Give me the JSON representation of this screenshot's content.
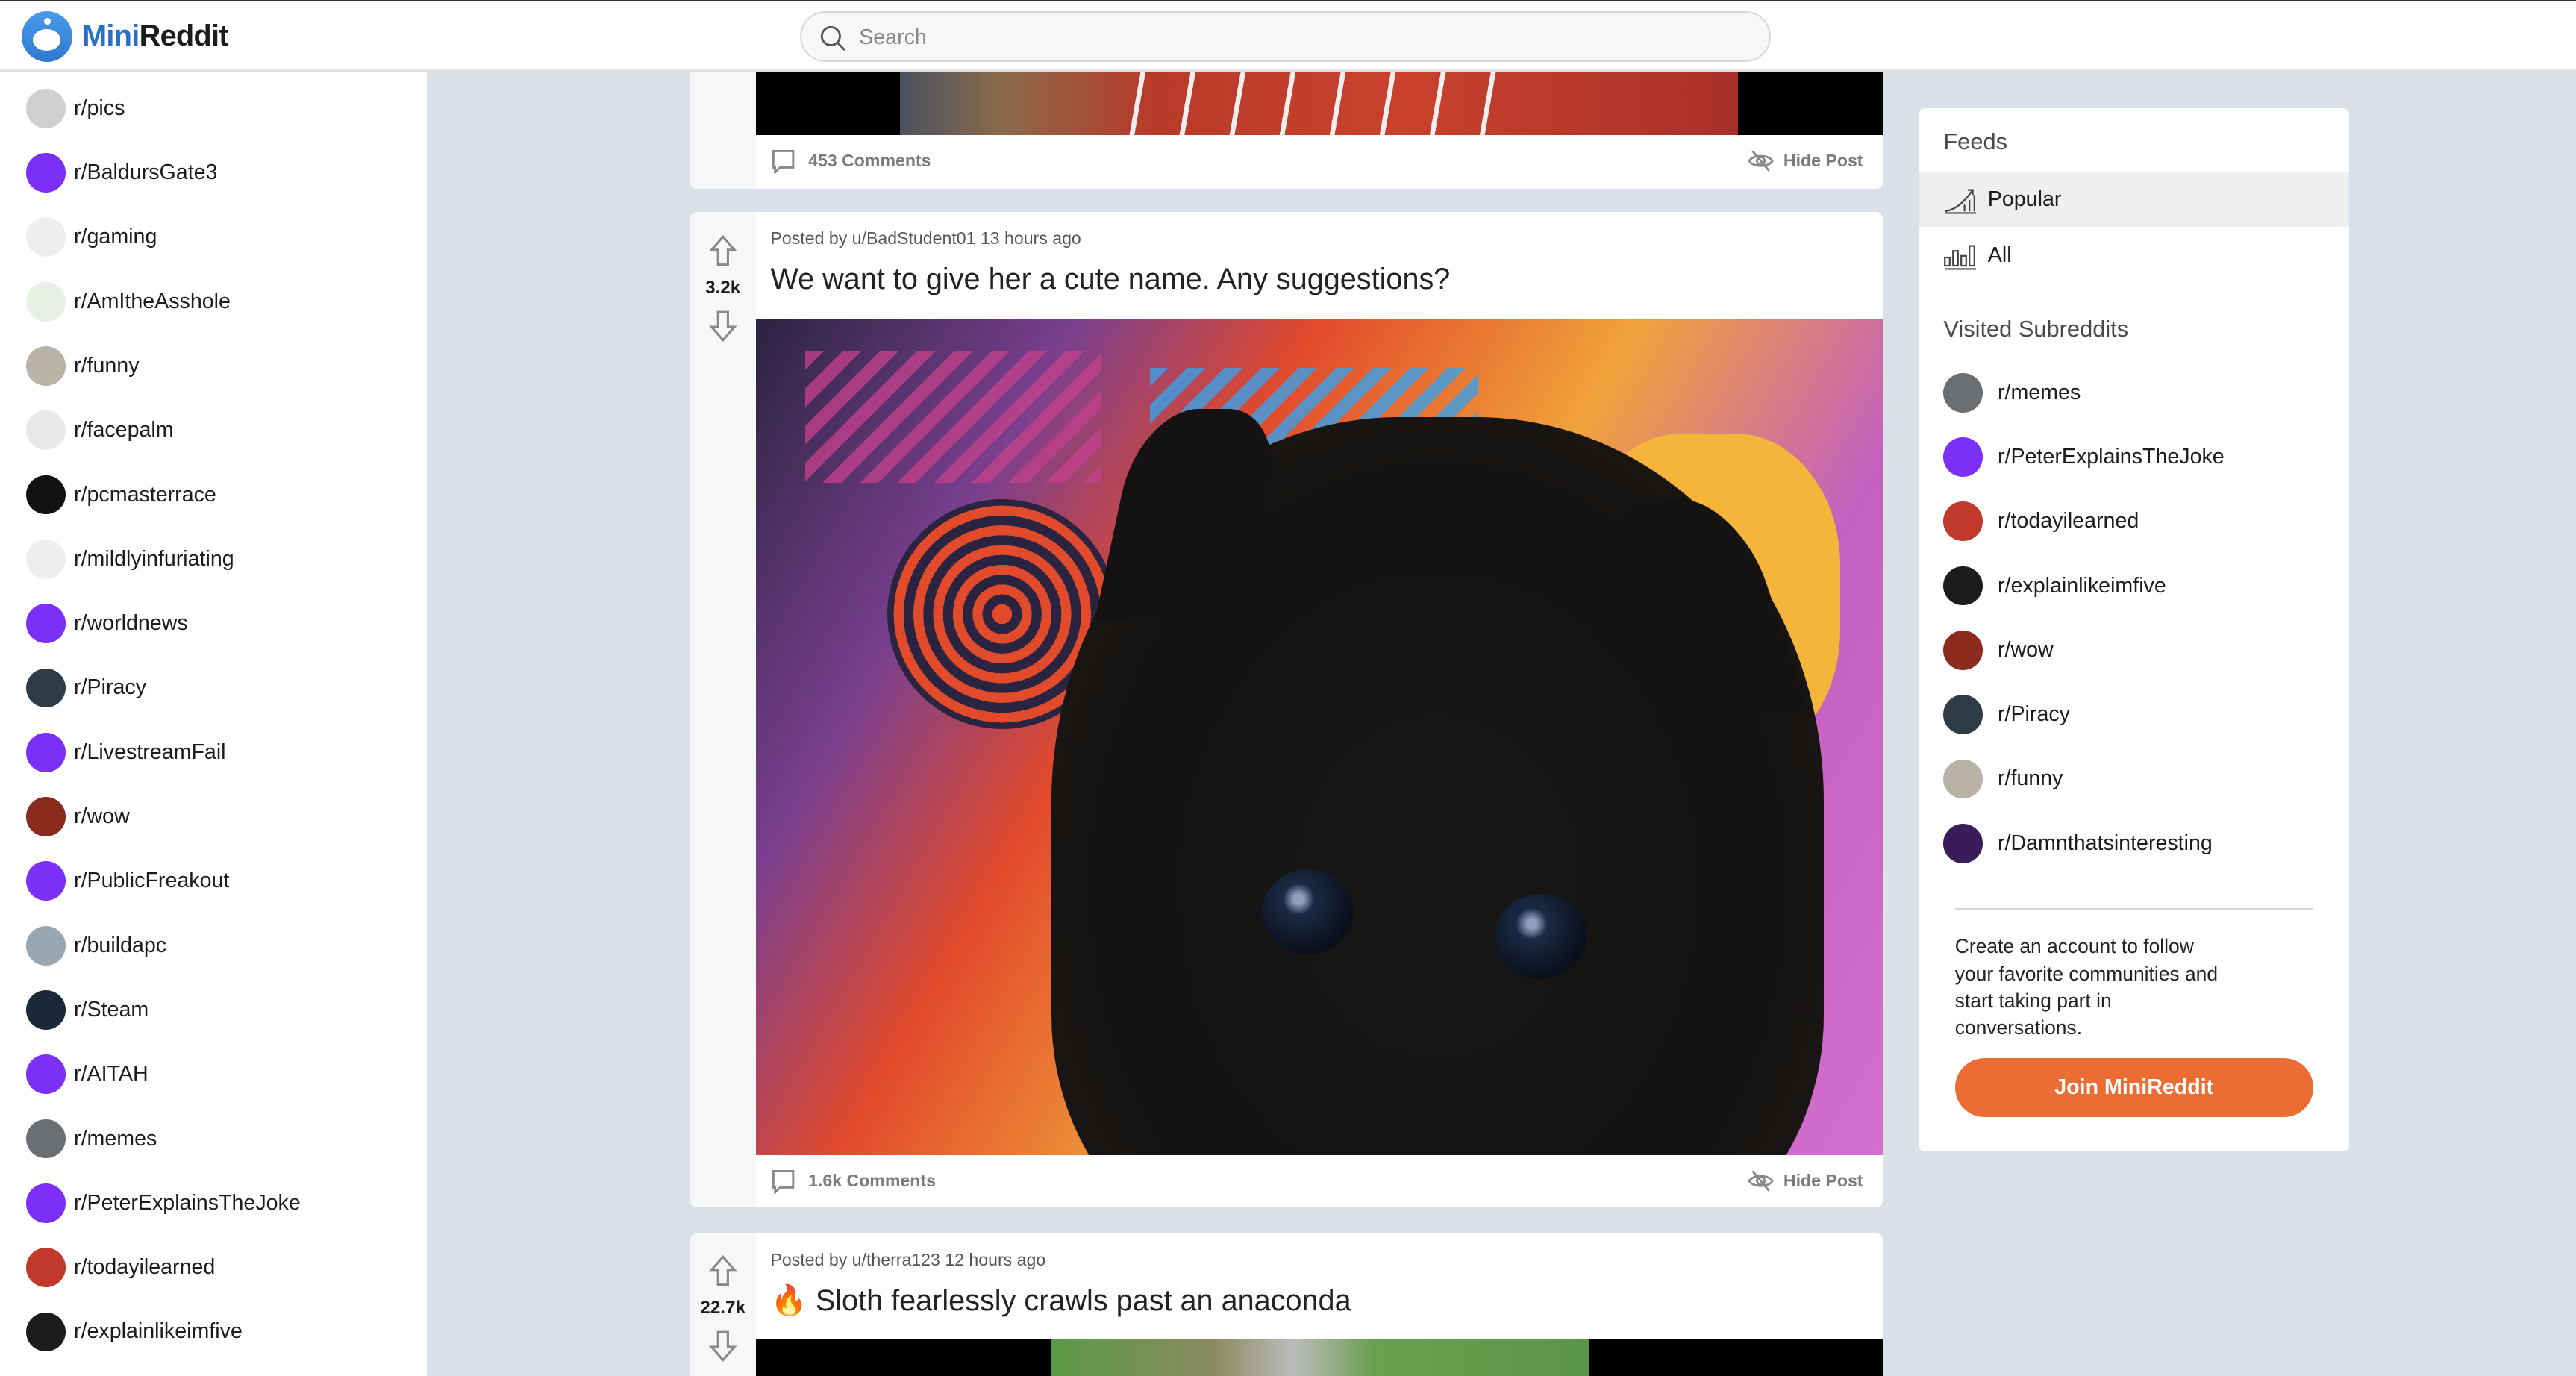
{
  "header": {
    "brand_part1": "Mini",
    "brand_part2": "Reddit",
    "search_placeholder": "Search",
    "search_value": ""
  },
  "sidebar": {
    "items": [
      {
        "label": "r/pics",
        "color": "#cfcfcf"
      },
      {
        "label": "r/BaldursGate3",
        "color": "#7b2ff7"
      },
      {
        "label": "r/gaming",
        "color": "#eeeeee"
      },
      {
        "label": "r/AmItheAsshole",
        "color": "#e8efe4"
      },
      {
        "label": "r/funny",
        "color": "#b9b2a6"
      },
      {
        "label": "r/facepalm",
        "color": "#e9e9e9"
      },
      {
        "label": "r/pcmasterrace",
        "color": "#111111"
      },
      {
        "label": "r/mildlyinfuriating",
        "color": "#eeeeee"
      },
      {
        "label": "r/worldnews",
        "color": "#7b2ff7"
      },
      {
        "label": "r/Piracy",
        "color": "#2f3b45"
      },
      {
        "label": "r/LivestreamFail",
        "color": "#7b2ff7"
      },
      {
        "label": "r/wow",
        "color": "#8a2b1e"
      },
      {
        "label": "r/PublicFreakout",
        "color": "#7b2ff7"
      },
      {
        "label": "r/buildapc",
        "color": "#9aa6b0"
      },
      {
        "label": "r/Steam",
        "color": "#1b2838"
      },
      {
        "label": "r/AITAH",
        "color": "#7b2ff7"
      },
      {
        "label": "r/memes",
        "color": "#6b6f73"
      },
      {
        "label": "r/PeterExplainsTheJoke",
        "color": "#7b2ff7"
      },
      {
        "label": "r/todayilearned",
        "color": "#c0392b"
      },
      {
        "label": "r/explainlikeimfive",
        "color": "#1c1c1c"
      }
    ]
  },
  "posts": [
    {
      "comments": "453 Comments",
      "hide": "Hide Post"
    },
    {
      "meta": "Posted by u/BadStudent01 13 hours ago",
      "title": "We want to give her a cute name. Any suggestions?",
      "votes": "3.2k",
      "comments": "1.6k Comments",
      "hide": "Hide Post"
    },
    {
      "meta": "Posted by u/therra123 12 hours ago",
      "flair_emoji": "🔥",
      "title": "Sloth fearlessly crawls past an anaconda",
      "votes": "22.7k"
    }
  ],
  "right": {
    "feeds_title": "Feeds",
    "feeds": [
      {
        "label": "Popular",
        "active": true
      },
      {
        "label": "All",
        "active": false
      }
    ],
    "visited_title": "Visited Subreddits",
    "visited": [
      {
        "label": "r/memes",
        "color": "#6b6f73"
      },
      {
        "label": "r/PeterExplainsTheJoke",
        "color": "#7b2ff7"
      },
      {
        "label": "r/todayilearned",
        "color": "#c0392b"
      },
      {
        "label": "r/explainlikeimfive",
        "color": "#1c1c1c"
      },
      {
        "label": "r/wow",
        "color": "#8a2b1e"
      },
      {
        "label": "r/Piracy",
        "color": "#2f3b45"
      },
      {
        "label": "r/funny",
        "color": "#b9b2a6"
      },
      {
        "label": "r/Damnthatsinteresting",
        "color": "#3a1c5a"
      }
    ],
    "cta": "Create an account to follow your favorite communities and start taking part in conversations.",
    "join": "Join MiniReddit"
  },
  "colors": {
    "accent": "#ec6d34",
    "brand": "#2a6fc9",
    "background": "#dae0e6"
  }
}
